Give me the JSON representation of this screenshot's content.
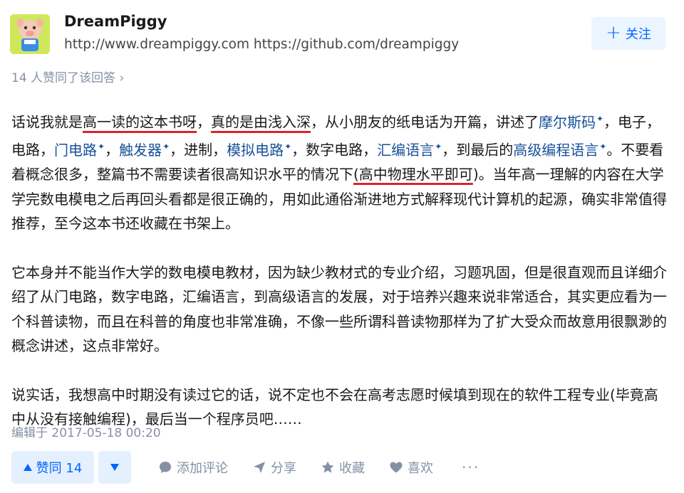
{
  "author": {
    "name": "DreamPiggy",
    "bio": "http://www.dreampiggy.com https://github.com/dreampiggy",
    "follow_label": "关注"
  },
  "voters_text": "14 人赞同了该回答 ›",
  "content": {
    "p1": {
      "t1": "话说我就是",
      "u1": "高一读的这本书呀",
      "t2": "，",
      "u2": "真的是由浅入深",
      "t3": "，从小朋友的纸电话为开篇，讲述了",
      "l1": "摩尔斯码",
      "t4": "，电子，电路，",
      "l2": "门电路",
      "t5": "，",
      "l3": "触发器",
      "t6": "，进制，",
      "l4": "模拟电路",
      "t7": "，数字电路，",
      "l5": "汇编语言",
      "t8": "，到最后的",
      "l6": "高级编程语言",
      "t9": "。不要看着概念很多，整篇书不需要读者很高知识水平的情况下",
      "u3": "(高中物理水平即可",
      "t10": ")。当年高一理解的内容在大学学完数电模电之后再回头看都是很正确的，用如此通俗渐进地方式解释现代计算机的起源，确实非常值得推荐，至今这本书还收藏在书架上。"
    },
    "p2": "它本身并不能当作大学的数电模电教材，因为缺少教材式的专业介绍，习题巩固，但是很直观而且详细介绍了从门电路，数字电路，汇编语言，到高级语言的发展，对于培养兴趣来说非常适合，其实更应看为一个科普读物，而且在科普的角度也非常准确，不像一些所谓科普读物那样为了扩大受众而故意用很飘渺的概念讲述，这点非常好。",
    "p3": "说实话，我想高中时期没有读过它的话，说不定也不会在高考志愿时候填到现在的软件工程专业(毕竟高中从没有接触编程)，最后当一个程序员吧……"
  },
  "edited": "编辑于 2017-05-18 00:20",
  "actions": {
    "vote_up_label": "赞同 14",
    "comment_label": "添加评论",
    "share_label": "分享",
    "favorite_label": "收藏",
    "like_label": "喜欢",
    "more_label": "···"
  },
  "colors": {
    "accent": "#0066ff",
    "link": "#175199",
    "underline": "#e0202b",
    "muted": "#8590a6"
  },
  "icons": {
    "plus": "plus-icon",
    "triangle_up": "triangle-up-icon",
    "triangle_down": "triangle-down-icon",
    "comment": "comment-icon",
    "share": "share-icon",
    "star": "star-icon",
    "heart": "heart-icon",
    "sparkle": "sparkle-icon"
  }
}
